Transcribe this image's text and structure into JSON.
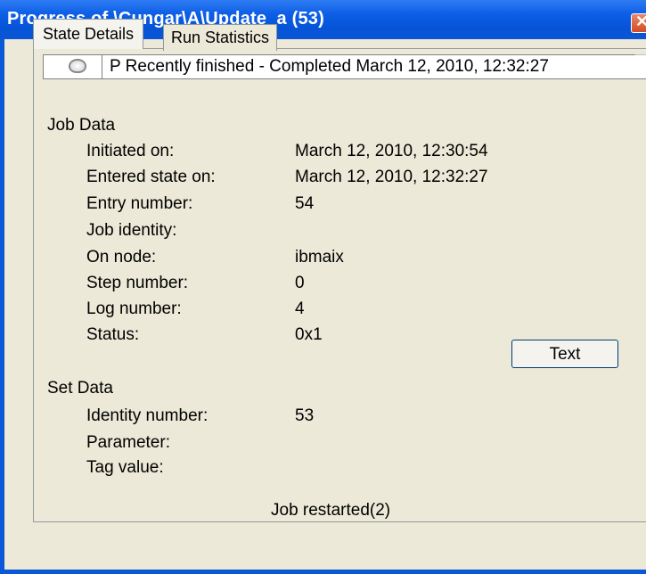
{
  "window": {
    "title": "Progress of \\Cungar\\A\\Update_a (53)",
    "close_glyph": "✕"
  },
  "tabs": [
    {
      "label": "State Details",
      "active": true
    },
    {
      "label": "Run Statistics",
      "active": false
    }
  ],
  "status_bar": {
    "icon": "cup-icon",
    "text": "P  Recently finished  -  Completed March 12, 2010, 12:32:27"
  },
  "job_data": {
    "heading": "Job Data",
    "rows": [
      {
        "label": "Initiated on:",
        "value": "March 12, 2010, 12:30:54"
      },
      {
        "label": "Entered state on:",
        "value": "March 12, 2010, 12:32:27"
      },
      {
        "label": "Entry number:",
        "value": "54"
      },
      {
        "label": "Job identity:",
        "value": ""
      },
      {
        "label": "On node:",
        "value": "ibmaix"
      },
      {
        "label": "Step number:",
        "value": "0"
      },
      {
        "label": "Log number:",
        "value": "4"
      },
      {
        "label": "Status:",
        "value": "0x1"
      }
    ],
    "text_button": "Text"
  },
  "set_data": {
    "heading": "Set Data",
    "rows": [
      {
        "label": "Identity number:",
        "value": "53"
      },
      {
        "label": "Parameter:",
        "value": ""
      },
      {
        "label": "Tag value:",
        "value": ""
      }
    ]
  },
  "footer": {
    "message": "Job restarted(2)"
  },
  "colors": {
    "titlebar": "#0a58d8",
    "dialog_bg": "#ece9d8"
  }
}
